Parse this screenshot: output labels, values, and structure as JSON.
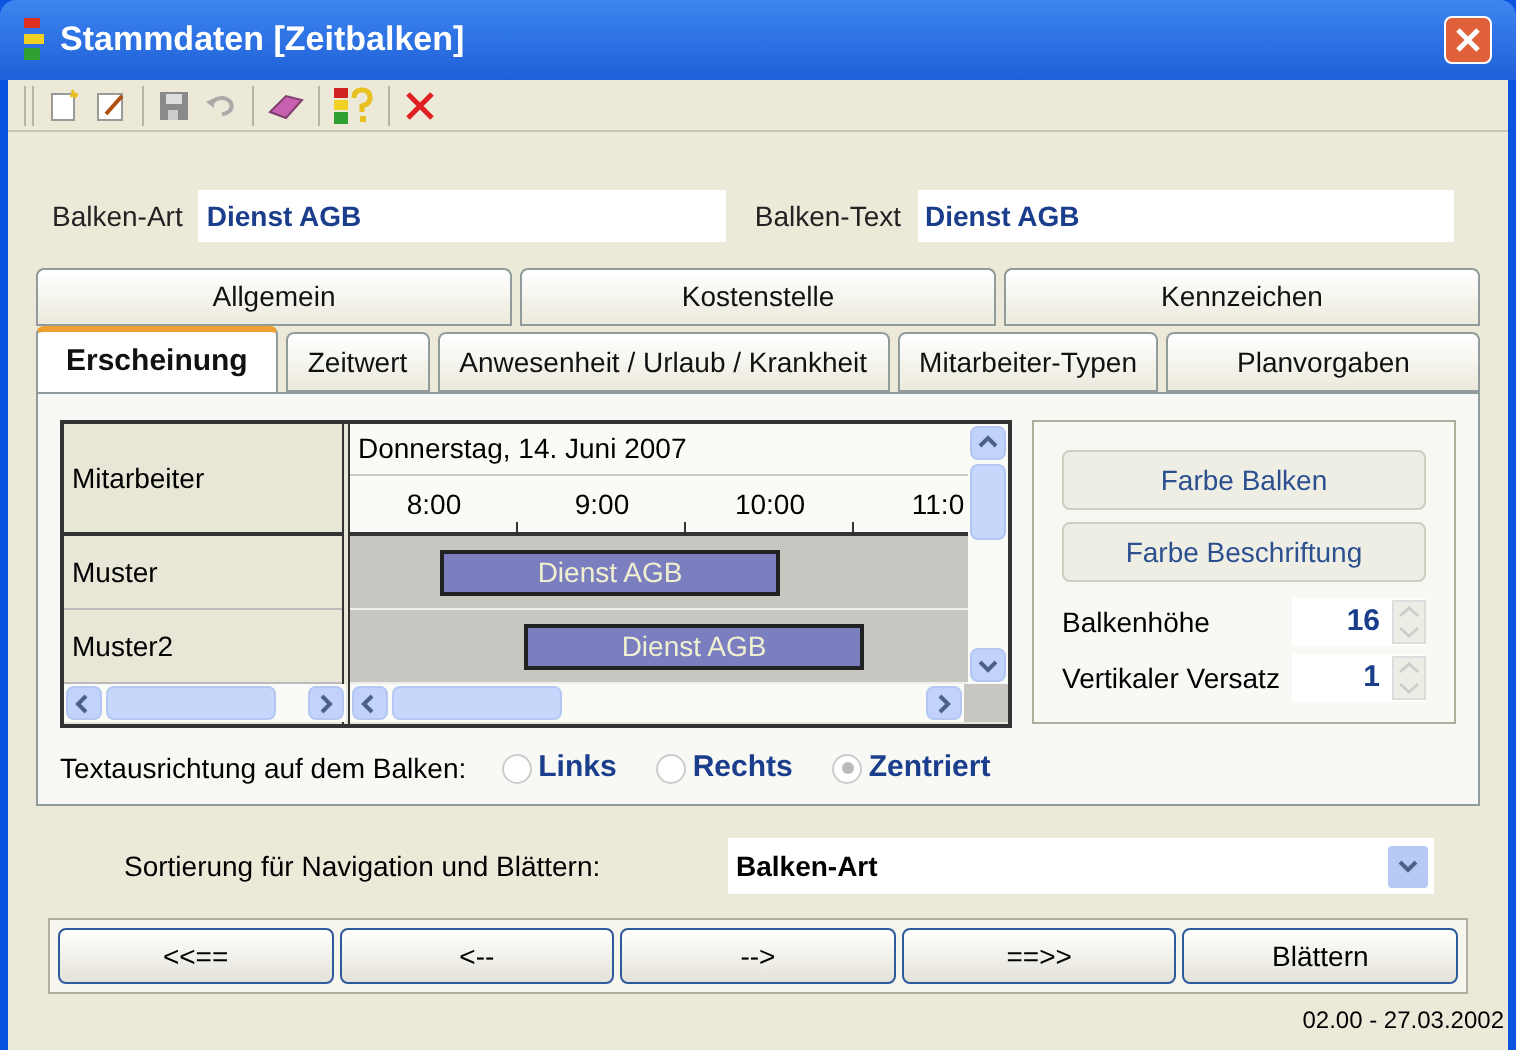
{
  "window": {
    "title": "Stammdaten [Zeitbalken]"
  },
  "fields": [
    {
      "label": "Balken-Art",
      "value": "Dienst AGB"
    },
    {
      "label": "Balken-Text",
      "value": "Dienst AGB"
    }
  ],
  "tab_rows": [
    [
      {
        "label": "Allgemein",
        "selected": false
      },
      {
        "label": "Kostenstelle",
        "selected": false
      },
      {
        "label": "Kennzeichen",
        "selected": false
      }
    ],
    [
      {
        "label": "Erscheinung",
        "selected": true
      },
      {
        "label": "Zeitwert",
        "selected": false
      },
      {
        "label": "Anwesenheit / Urlaub / Krankheit",
        "selected": false
      },
      {
        "label": "Mitarbeiter-Typen",
        "selected": false
      },
      {
        "label": "Planvorgaben",
        "selected": false
      }
    ]
  ],
  "timeline": {
    "row_header": "Mitarbeiter",
    "date": "Donnerstag, 14. Juni 2007",
    "hours": [
      "8:00",
      "9:00",
      "10:00",
      "11:0"
    ],
    "rows": [
      {
        "name": "Muster",
        "bar": "Dienst AGB"
      },
      {
        "name": "Muster2",
        "bar": "Dienst AGB"
      }
    ]
  },
  "alignment": {
    "label": "Textausrichtung auf dem Balken:",
    "options": [
      {
        "label": "Links",
        "selected": false
      },
      {
        "label": "Rechts",
        "selected": false
      },
      {
        "label": "Zentriert",
        "selected": true
      }
    ]
  },
  "color_buttons": [
    "Farbe Balken",
    "Farbe Beschriftung"
  ],
  "spinners": [
    {
      "label": "Balkenhöhe",
      "value": "16"
    },
    {
      "label": "Vertikaler Versatz",
      "value": "1"
    }
  ],
  "sort": {
    "label": "Sortierung für Navigation und Blättern:",
    "value": "Balken-Art"
  },
  "nav_buttons": [
    "<<==",
    "<--",
    "-->",
    "==>>",
    "Blättern"
  ],
  "status": "02.00 - 27.03.2002"
}
